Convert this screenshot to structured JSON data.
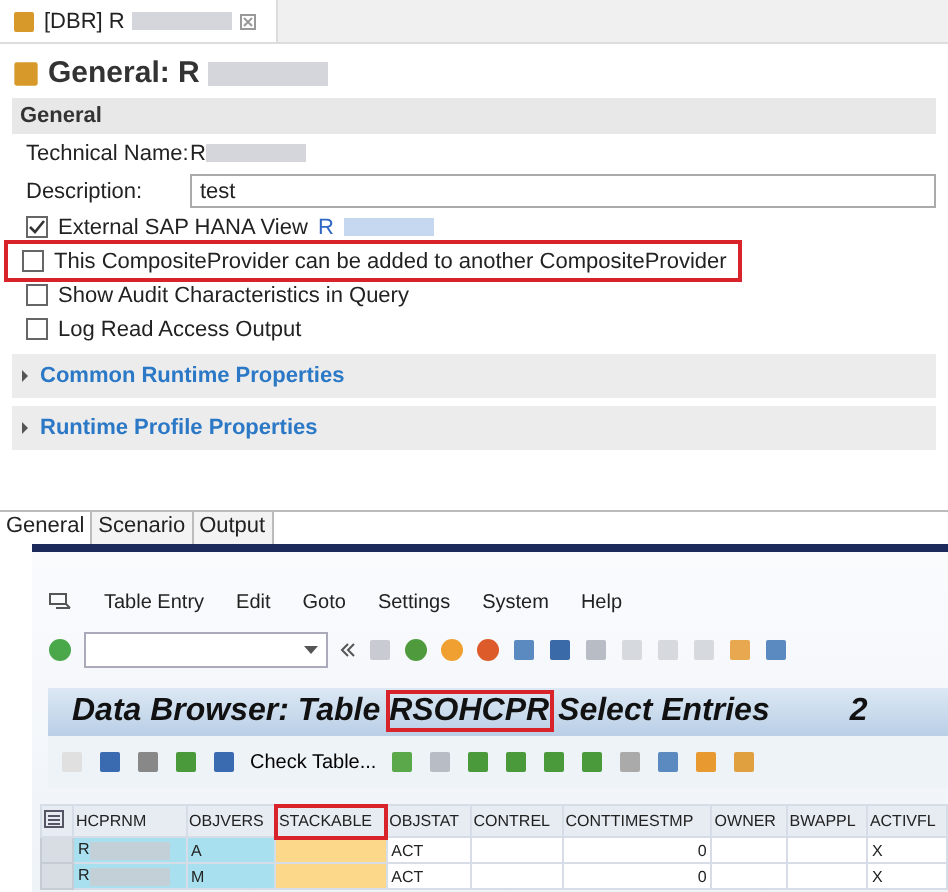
{
  "editor_tab": {
    "title": "[DBR] R"
  },
  "heading": "General: R",
  "general_section": {
    "title": "General",
    "technical_name_label": "Technical Name:",
    "technical_name": "R",
    "description_label": "Description:",
    "description": "test",
    "options": [
      {
        "label": "External SAP HANA View",
        "checked": true,
        "link": "R",
        "highlighted": false
      },
      {
        "label": "This CompositeProvider can be added to another CompositeProvider",
        "checked": false,
        "highlighted": true
      },
      {
        "label": "Show Audit Characteristics in Query",
        "checked": false,
        "highlighted": false
      },
      {
        "label": "Log Read Access Output",
        "checked": false,
        "highlighted": false
      }
    ]
  },
  "collapsible_sections": [
    {
      "title": "Common Runtime Properties",
      "expanded": false
    },
    {
      "title": "Runtime Profile Properties",
      "expanded": false
    }
  ],
  "bottom_tabs": [
    {
      "label": "General",
      "selected": true
    },
    {
      "label": "Scenario",
      "selected": false
    },
    {
      "label": "Output",
      "selected": false
    }
  ],
  "sap_window": {
    "menu": [
      "Table Entry",
      "Edit",
      "Goto",
      "Settings",
      "System",
      "Help"
    ],
    "title_prefix": "Data Browser: Table ",
    "table_name": "RSOHCPR",
    "title_suffix": " Select Entries",
    "count": "2",
    "toolbar_button": "Check Table...",
    "table": {
      "columns": [
        {
          "label": "HCPRNM",
          "highlighted": false
        },
        {
          "label": "OBJVERS",
          "highlighted": false
        },
        {
          "label": "STACKABLE",
          "highlighted": true
        },
        {
          "label": "OBJSTAT",
          "highlighted": false
        },
        {
          "label": "CONTREL",
          "highlighted": false
        },
        {
          "label": "CONTTIMESTMP",
          "highlighted": false
        },
        {
          "label": "OWNER",
          "highlighted": false
        },
        {
          "label": "BWAPPL",
          "highlighted": false
        },
        {
          "label": "ACTIVFL",
          "highlighted": false
        }
      ],
      "rows": [
        [
          "R",
          "A",
          "",
          "ACT",
          "",
          "0",
          "",
          "",
          "X"
        ],
        [
          "R",
          "M",
          "",
          "ACT",
          "",
          "0",
          "",
          "",
          "X"
        ]
      ]
    }
  }
}
